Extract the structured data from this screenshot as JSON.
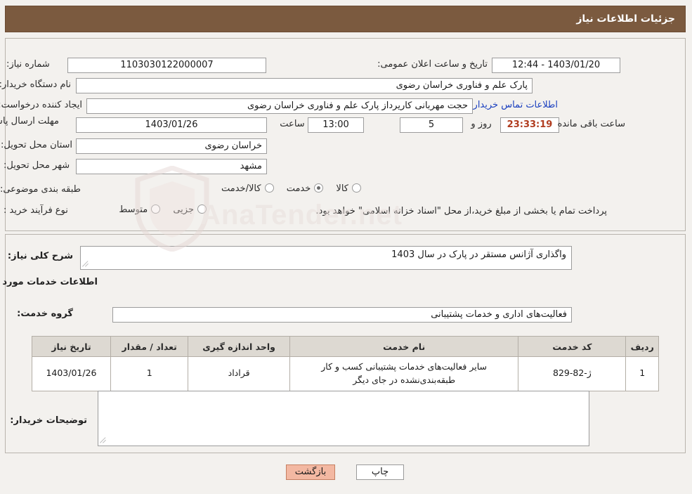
{
  "header": {
    "title": "جزئیات اطلاعات نیاز"
  },
  "form": {
    "need_number_label": "شماره نیاز:",
    "need_number_value": "1103030122000007",
    "public_announce_label": "تاریخ و ساعت اعلان عمومی:",
    "public_announce_value": "1403/01/20 - 12:44",
    "buyer_org_label": "نام دستگاه خریدار:",
    "buyer_org_value": "پارک علم و فناوری خراسان رضوی",
    "requester_label": "ایجاد کننده درخواست:",
    "requester_value": "حجت مهربانی کاریرداز پارک علم و فناوری خراسان رضوی",
    "contact_link": "اطلاعات تماس خریدار",
    "deadline_label": "مهلت ارسال پاسخ: تا تاریخ:",
    "deadline_date": "1403/01/26",
    "time_label": "ساعت",
    "deadline_time": "13:00",
    "days_value": "5",
    "days_label": "روز و",
    "countdown_value": "23:33:19",
    "remaining_label": "ساعت باقی مانده",
    "province_label": "استان محل تحویل:",
    "province_value": "خراسان رضوی",
    "city_label": "شهر محل تحویل:",
    "city_value": "مشهد",
    "category_label": "طبقه بندی موضوعی:",
    "category_options": [
      "کالا",
      "خدمت",
      "کالا/خدمت"
    ],
    "category_selected": "خدمت",
    "purchase_type_label": "نوع فرآیند خرید :",
    "purchase_options": [
      "جزیی",
      "متوسط"
    ],
    "purchase_selected": "",
    "purchase_note": "پرداخت تمام یا بخشی از مبلغ خرید،از محل \"اسناد خزانه اسلامی\" خواهد بود."
  },
  "description": {
    "overall_label": "شرح کلی نیاز:",
    "overall_value": "واگذاری آژانس مستقر در پارک در سال 1403",
    "services_title": "اطلاعات خدمات مورد نیاز",
    "group_label": "گروه خدمت:",
    "group_value": "فعالیت‌های اداری و خدمات پشتیبانی",
    "buyer_notes_label": "توضیحات خریدار:",
    "buyer_notes_value": ""
  },
  "table": {
    "headers": [
      "ردیف",
      "کد خدمت",
      "نام خدمت",
      "واحد اندازه گیری",
      "تعداد / مقدار",
      "تاریخ نیاز"
    ],
    "rows": [
      {
        "row": "1",
        "code": "ژ-82-829",
        "name": "سایر فعالیت‌های خدمات پشتیبانی کسب و کار طبقه‌بندی‌نشده در جای دیگر",
        "unit": "قراداد",
        "qty": "1",
        "date": "1403/01/26"
      }
    ]
  },
  "footer": {
    "print_label": "چاپ",
    "back_label": "بازگشت"
  },
  "watermark": {
    "text": "AnaTender.net"
  }
}
